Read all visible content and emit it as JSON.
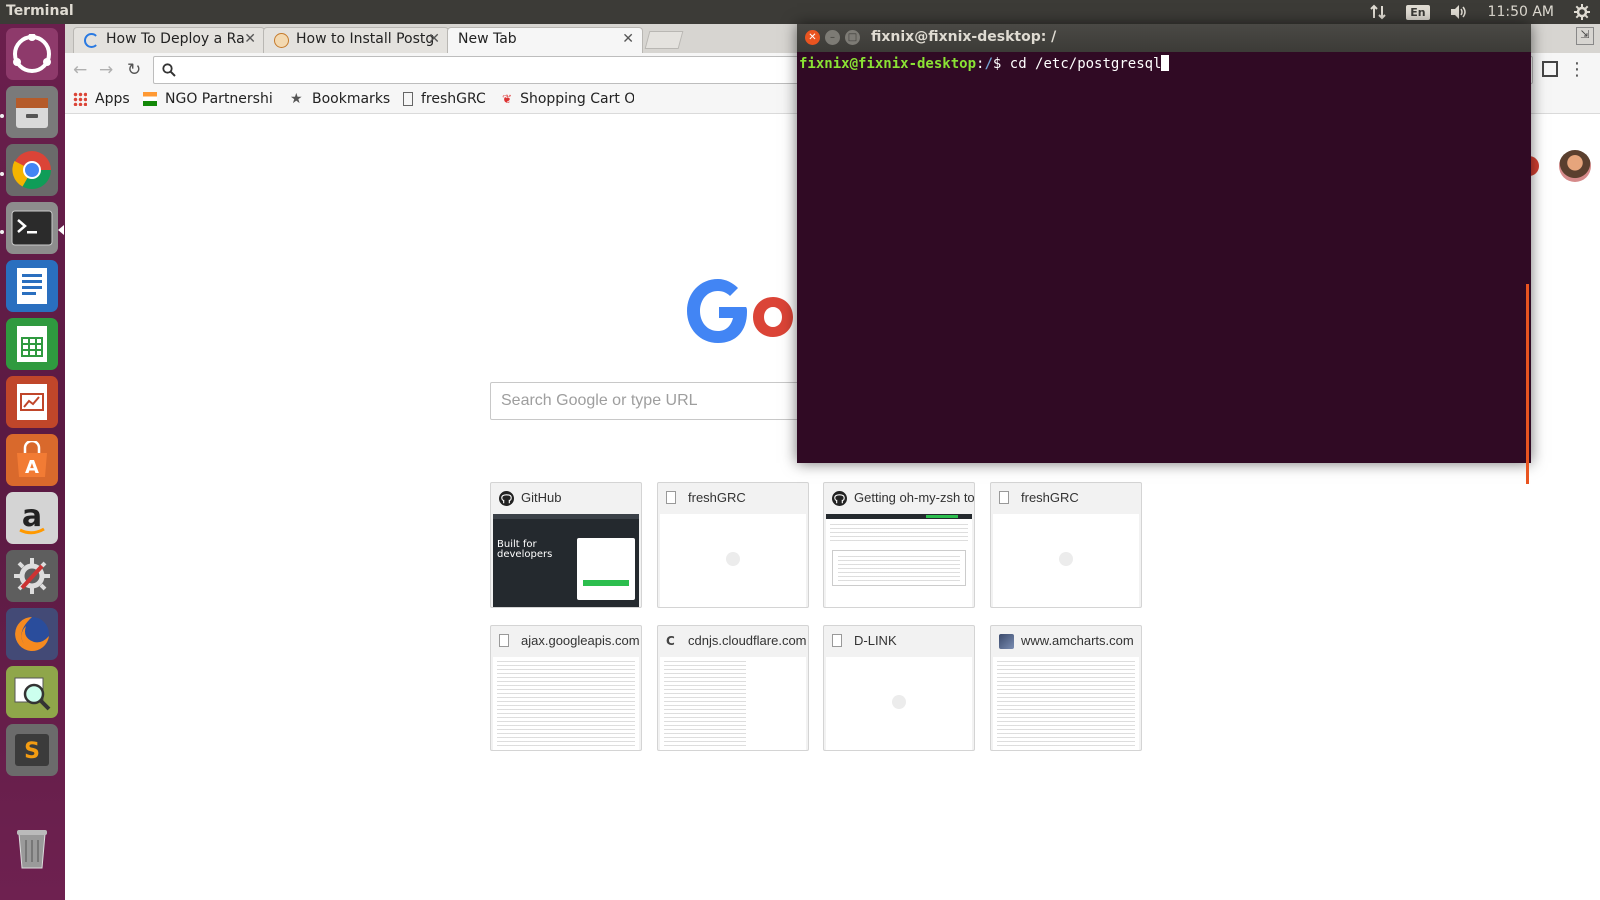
{
  "top_panel": {
    "app_title": "Terminal",
    "keyboard_lang": "En",
    "clock": "11:50 AM"
  },
  "launcher": {
    "items": [
      "ubuntu-dash",
      "files",
      "chrome",
      "terminal",
      "writer",
      "calc",
      "impress",
      "software-center",
      "amazon",
      "system-settings",
      "firefox",
      "image-viewer",
      "sublime-text",
      "trash"
    ]
  },
  "browser": {
    "tabs": [
      {
        "title": "How To Deploy a Ra",
        "active": false
      },
      {
        "title": "How to Install Postg",
        "active": false
      },
      {
        "title": "New Tab",
        "active": true
      }
    ],
    "bookmarks": [
      {
        "label": "Apps"
      },
      {
        "label": "NGO Partnershi"
      },
      {
        "label": "Bookmarks"
      },
      {
        "label": "freshGRC"
      },
      {
        "label": "Shopping Cart O"
      }
    ],
    "address_value": "",
    "search_placeholder": "Search Google or type URL",
    "tiles": [
      {
        "title": "GitHub",
        "thumb": "github-page",
        "thumb_heading": "Built for developers"
      },
      {
        "title": "freshGRC",
        "thumb": "blank"
      },
      {
        "title": "Getting oh-my-zsh to w",
        "thumb": "github-issue"
      },
      {
        "title": "freshGRC",
        "thumb": "blank"
      },
      {
        "title": "ajax.googleapis.com",
        "thumb": "text"
      },
      {
        "title": "cdnjs.cloudflare.com",
        "thumb": "text"
      },
      {
        "title": "D-LINK",
        "thumb": "blank"
      },
      {
        "title": "www.amcharts.com",
        "thumb": "text"
      }
    ]
  },
  "terminal": {
    "window_title": "fixnix@fixnix-desktop: /",
    "prompt_user": "fixnix@fixnix-desktop",
    "prompt_sep": ":",
    "prompt_path": "/",
    "prompt_symbol": "$",
    "command": "cd /etc/postgresql"
  },
  "colors": {
    "terminal_bg": "#300a24",
    "prompt_green": "#8ae234",
    "prompt_blue": "#729fcf",
    "launcher_bg": "#5e1b46",
    "panel_bg": "#3c3b37"
  }
}
